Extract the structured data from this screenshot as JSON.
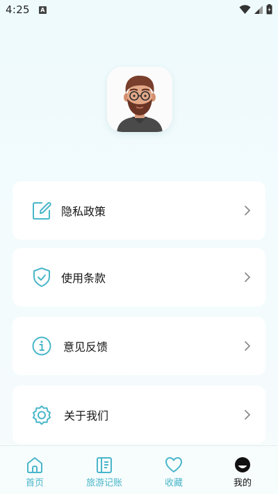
{
  "status_bar": {
    "time": "4:25",
    "indicator": "A"
  },
  "profile": {
    "avatar": "avatar-bearded-man"
  },
  "menu": [
    {
      "label": "隐私政策",
      "icon": "edit-icon"
    },
    {
      "label": "使用条款",
      "icon": "shield-check-icon"
    },
    {
      "label": "意见反馈",
      "icon": "info-icon"
    },
    {
      "label": "关于我们",
      "icon": "gear-icon"
    }
  ],
  "tabbar": {
    "tabs": [
      {
        "label": "首页",
        "icon": "home-icon"
      },
      {
        "label": "旅游记账",
        "icon": "ledger-icon"
      },
      {
        "label": "收藏",
        "icon": "heart-icon"
      },
      {
        "label": "我的",
        "icon": "profile-face-icon"
      }
    ],
    "active_index": 3
  },
  "colors": {
    "accent": "#49b6c9",
    "active": "#111111",
    "card": "#ffffff",
    "background": "#f1fafc"
  }
}
